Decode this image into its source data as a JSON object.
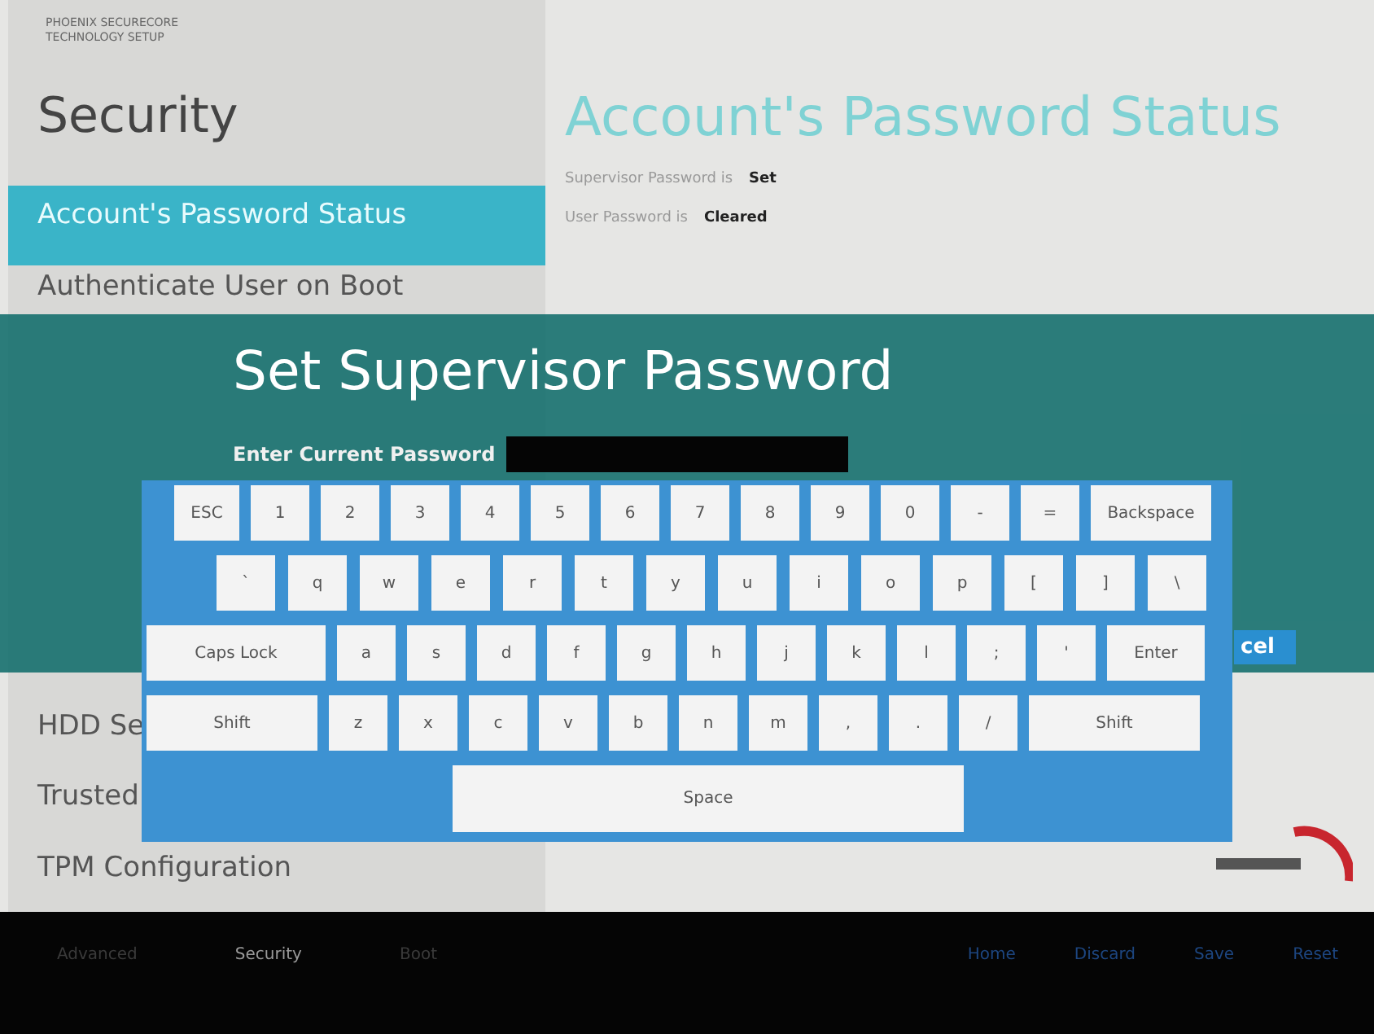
{
  "brand": [
    "PHOENIX SECURECORE",
    "TECHNOLOGY SETUP"
  ],
  "sidebar": {
    "title": "Security",
    "items": [
      {
        "label": "Account's Password Status",
        "selected": true
      },
      {
        "label": "Authenticate User on Boot",
        "selected": false
      },
      {
        "label": "HDD Se",
        "selected": false
      },
      {
        "label": "Trusted",
        "selected": false
      },
      {
        "label": "TPM Configuration",
        "selected": false
      }
    ]
  },
  "content": {
    "title": "Account's Password Status",
    "fields": [
      {
        "label": "Supervisor Password is",
        "value": "Set"
      },
      {
        "label": "User Password is",
        "value": "Cleared"
      }
    ]
  },
  "dialog": {
    "title": "Set Supervisor Password",
    "field_label": "Enter Current Password",
    "cancel_fragment": "cel"
  },
  "keyboard": {
    "rows": [
      [
        {
          "label": "ESC",
          "kind": "esc"
        },
        {
          "label": "1",
          "kind": "key"
        },
        {
          "label": "2",
          "kind": "key"
        },
        {
          "label": "3",
          "kind": "key"
        },
        {
          "label": "4",
          "kind": "key"
        },
        {
          "label": "5",
          "kind": "key"
        },
        {
          "label": "6",
          "kind": "key"
        },
        {
          "label": "7",
          "kind": "key"
        },
        {
          "label": "8",
          "kind": "key"
        },
        {
          "label": "9",
          "kind": "key"
        },
        {
          "label": "0",
          "kind": "key"
        },
        {
          "label": "-",
          "kind": "key"
        },
        {
          "label": "=",
          "kind": "key"
        },
        {
          "label": "Backspace",
          "kind": "backspace"
        }
      ],
      [
        {
          "label": "`",
          "kind": "key"
        },
        {
          "label": "q",
          "kind": "key"
        },
        {
          "label": "w",
          "kind": "key"
        },
        {
          "label": "e",
          "kind": "key"
        },
        {
          "label": "r",
          "kind": "key"
        },
        {
          "label": "t",
          "kind": "key"
        },
        {
          "label": "y",
          "kind": "key"
        },
        {
          "label": "u",
          "kind": "key"
        },
        {
          "label": "i",
          "kind": "key"
        },
        {
          "label": "o",
          "kind": "key"
        },
        {
          "label": "p",
          "kind": "key"
        },
        {
          "label": "[",
          "kind": "key"
        },
        {
          "label": "]",
          "kind": "key"
        },
        {
          "label": "\\",
          "kind": "key"
        }
      ],
      [
        {
          "label": "Caps Lock",
          "kind": "caps"
        },
        {
          "label": "a",
          "kind": "key"
        },
        {
          "label": "s",
          "kind": "key"
        },
        {
          "label": "d",
          "kind": "key"
        },
        {
          "label": "f",
          "kind": "key"
        },
        {
          "label": "g",
          "kind": "key"
        },
        {
          "label": "h",
          "kind": "key"
        },
        {
          "label": "j",
          "kind": "key"
        },
        {
          "label": "k",
          "kind": "key"
        },
        {
          "label": "l",
          "kind": "key"
        },
        {
          "label": ";",
          "kind": "key"
        },
        {
          "label": "'",
          "kind": "key"
        },
        {
          "label": "Enter",
          "kind": "enter"
        }
      ],
      [
        {
          "label": "Shift",
          "kind": "shift"
        },
        {
          "label": "z",
          "kind": "key"
        },
        {
          "label": "x",
          "kind": "key"
        },
        {
          "label": "c",
          "kind": "key"
        },
        {
          "label": "v",
          "kind": "key"
        },
        {
          "label": "b",
          "kind": "key"
        },
        {
          "label": "n",
          "kind": "key"
        },
        {
          "label": "m",
          "kind": "key"
        },
        {
          "label": ",",
          "kind": "key"
        },
        {
          "label": ".",
          "kind": "key"
        },
        {
          "label": "/",
          "kind": "key"
        },
        {
          "label": "Shift",
          "kind": "shift"
        }
      ],
      [
        {
          "label": "Space",
          "kind": "space"
        }
      ]
    ]
  },
  "footer": {
    "tabs": [
      {
        "label": "Advanced",
        "selected": false
      },
      {
        "label": "Security",
        "selected": true
      },
      {
        "label": "Boot",
        "selected": false
      }
    ],
    "actions": [
      "Home",
      "Discard",
      "Save",
      "Reset"
    ]
  }
}
